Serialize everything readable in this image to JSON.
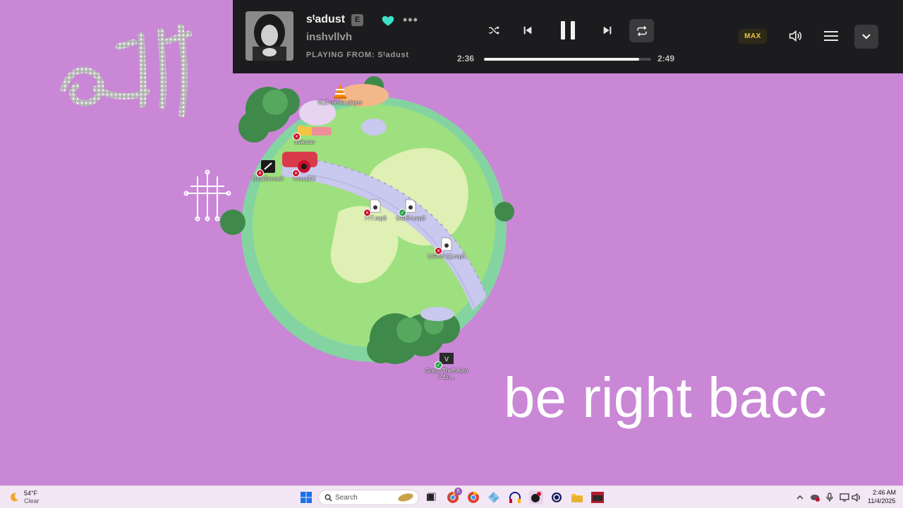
{
  "player": {
    "track_title": "sᵗadust",
    "explicit_label": "E",
    "artist": "inshvllvh",
    "playing_from": "PLAYING FROM: Sᵗadust",
    "elapsed": "2:36",
    "duration": "2:49",
    "progress_fraction": 0.93,
    "quality_badge": "MAX",
    "more_label": "•••",
    "liked": true,
    "shuffle_on": false,
    "repeat_on": true,
    "accent_color": "#3ee0c8"
  },
  "desktop": {
    "icons": [
      {
        "label": "VLC media player",
        "icon": "vlc-icon",
        "status": "none"
      },
      {
        "label": "inakwav",
        "icon": "folder-icon",
        "status": "error"
      },
      {
        "label": "DualSenseX",
        "icon": "app-icon",
        "status": "error"
      },
      {
        "label": "VirtualDJ",
        "icon": "virtualdj-icon",
        "status": "error"
      },
      {
        "label": "777.mp3",
        "icon": "audio-file-icon",
        "status": "error"
      },
      {
        "label": "UGHH.mp3",
        "icon": "audio-file-icon",
        "status": "ok"
      },
      {
        "label": "UGHH (1).mp3",
        "icon": "audio-file-icon",
        "status": "error"
      },
      {
        "label": "Grand Theft Auto V En...",
        "icon": "gta-icon",
        "status": "ok"
      }
    ],
    "overlay_text": "be right bacc"
  },
  "taskbar": {
    "weather_temp": "54°F",
    "weather_condition": "Clear",
    "search_placeholder": "Search",
    "apps": [
      "start-icon",
      "search-icon",
      "task-view-icon",
      "chrome-badge-icon",
      "chrome-icon",
      "pinwheel-icon",
      "headphones-icon",
      "record-icon",
      "circle-app-icon",
      "file-explorer-icon",
      "video-app-icon"
    ],
    "chrome_badge_count": "5",
    "clock_time": "2:46 AM",
    "clock_date": "11/4/2025"
  }
}
